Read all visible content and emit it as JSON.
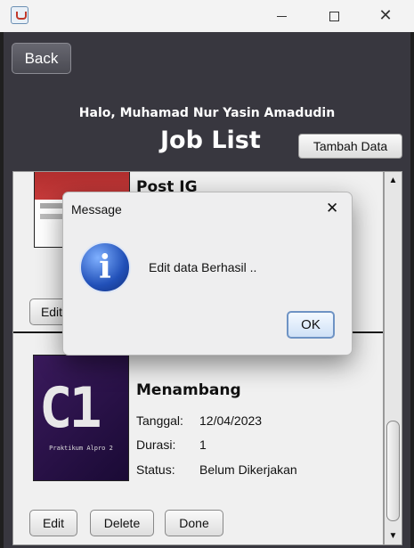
{
  "window": {
    "app_icon": "java-icon"
  },
  "header": {
    "back_label": "Back",
    "greeting": "Halo, Muhamad Nur Yasin Amadudin",
    "title": "Job List",
    "add_label": "Tambah Data"
  },
  "jobs": [
    {
      "title": "Post IG",
      "edit_label": "Edit"
    },
    {
      "title": "Menambang",
      "thumb_text": "C1",
      "thumb_subtext": "Praktikum Alpro 2",
      "fields": [
        {
          "label": "Tanggal:",
          "value": "12/04/2023"
        },
        {
          "label": "Durasi:",
          "value": "1"
        },
        {
          "label": "Status:",
          "value": "Belum Dikerjakan"
        }
      ],
      "edit_label": "Edit",
      "delete_label": "Delete",
      "done_label": "Done"
    }
  ],
  "dialog": {
    "title": "Message",
    "message": "Edit data Berhasil ..",
    "ok_label": "OK",
    "icon": "info-icon"
  },
  "colors": {
    "background": "#38373f",
    "dialog": "#eeeeef",
    "accent": "#2150b8"
  }
}
